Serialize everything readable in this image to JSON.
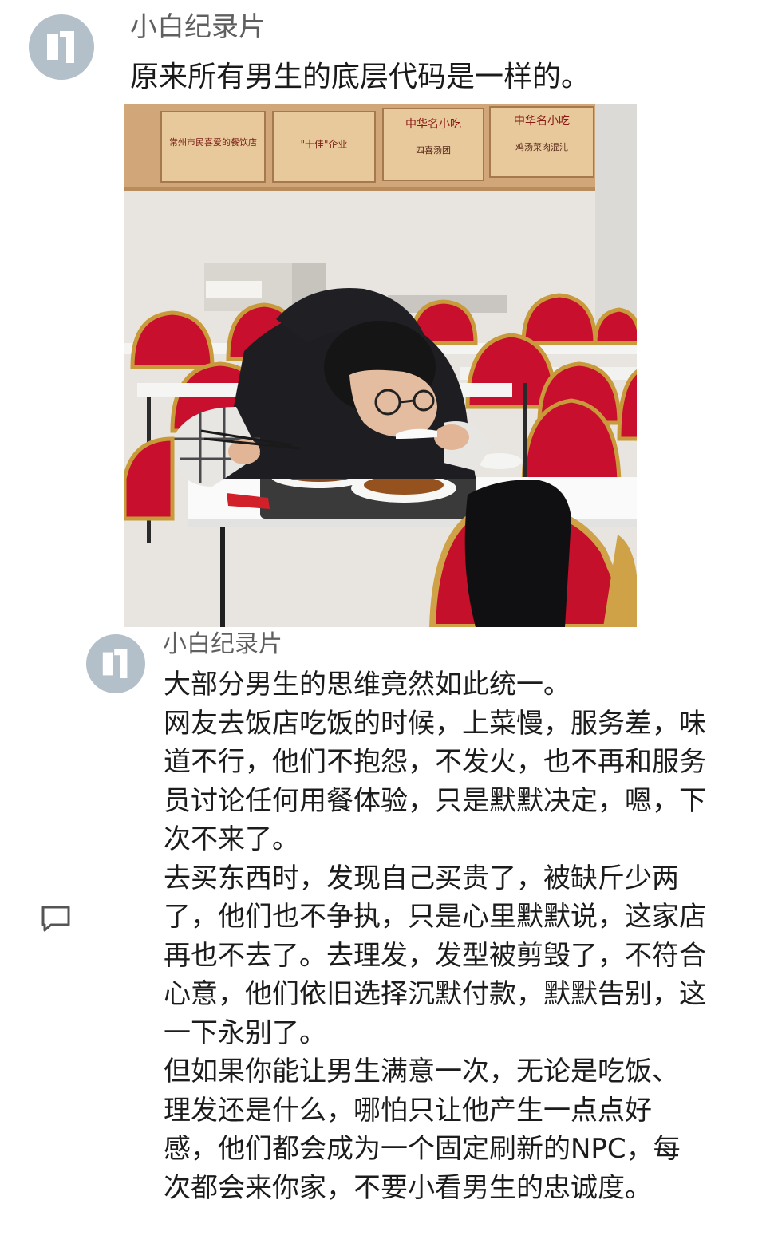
{
  "post": {
    "username": "小白纪录片",
    "text": "原来所有男生的底层代码是一样的。",
    "photo": {
      "plaques": [
        {
          "top": "常州市民喜爱的餐饮店"
        },
        {
          "top": "\"十佳\"企业"
        },
        {
          "top": "中华名小吃",
          "bottom": "四喜汤团"
        },
        {
          "top": "中华名小吃",
          "bottom": "鸡汤菜肉混沌"
        }
      ]
    }
  },
  "comment": {
    "username": "小白纪录片",
    "lines": [
      "大部分男生的思维竟然如此统一。",
      "网友去饭店吃饭的时候，上菜慢，服务差，味",
      "道不行，他们不抱怨，不发火，也不再和服务",
      "员讨论任何用餐体验，只是默默决定，嗯，下",
      "次不来了。",
      "去买东西时，发现自己买贵了，被缺斤少两",
      "了，他们也不争执，只是心里默默说，这家店",
      "再也不去了。去理发，发型被剪毁了，不符合",
      "心意，他们依旧选择沉默付款，默默告别，这",
      "一下永别了。",
      "但如果你能让男生满意一次，无论是吃饭、",
      "理发还是什么，哪怕只让他产生一点点好",
      "感，他们都会成为一个固定刷新的NPC，每",
      "次都会来你家，不要小看男生的忠诚度。"
    ]
  },
  "icons": {
    "avatar": "avatar-logo-icon",
    "reply": "comment-bubble-icon"
  }
}
